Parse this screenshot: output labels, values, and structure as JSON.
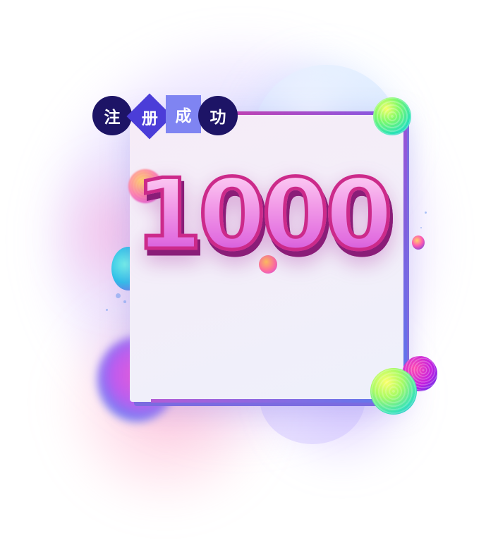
{
  "title_chars": [
    "注",
    "册",
    "成",
    "功"
  ],
  "headline_number": "1000",
  "colors": {
    "badge_dark": "#1d1466",
    "badge_diamond": "#4b3dd8",
    "badge_square": "#7f84f2",
    "number_fill": "#f29be8",
    "number_stroke": "#cc2a8a",
    "frame_top": "#e0318f",
    "frame_right": "#5a78ee"
  }
}
